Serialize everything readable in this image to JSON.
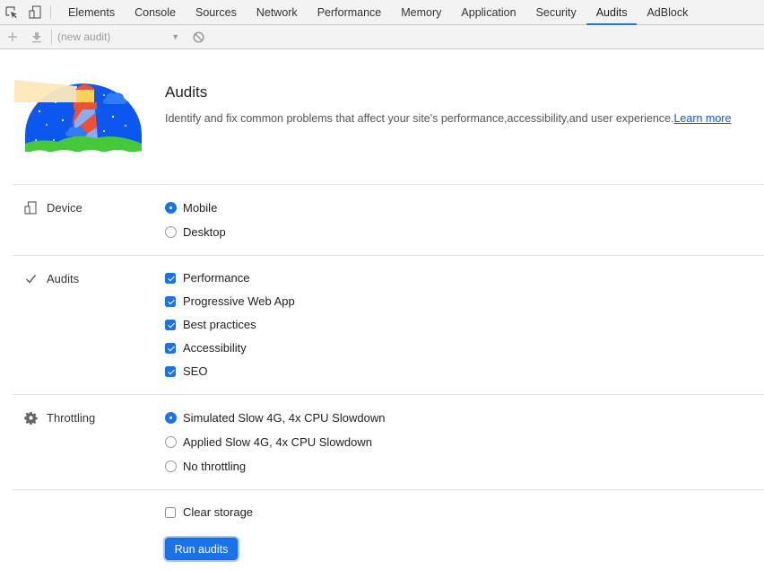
{
  "tabbar": {
    "tabs": [
      {
        "label": "Elements"
      },
      {
        "label": "Console"
      },
      {
        "label": "Sources"
      },
      {
        "label": "Network"
      },
      {
        "label": "Performance"
      },
      {
        "label": "Memory"
      },
      {
        "label": "Application"
      },
      {
        "label": "Security"
      },
      {
        "label": "Audits",
        "active": true
      },
      {
        "label": "AdBlock"
      }
    ],
    "icons": [
      "inspect-element-icon",
      "device-toolbar-icon"
    ]
  },
  "toolbar": {
    "audit_select_value": "(new audit)",
    "icons": [
      "add-icon",
      "download-icon",
      "clear-icon"
    ]
  },
  "header": {
    "title": "Audits",
    "description": "Identify and fix common problems that affect your site's performance,accessibility,and user experience.",
    "learn_more": "Learn more"
  },
  "sections": {
    "device": {
      "label": "Device",
      "icon": "device-icon",
      "options": [
        {
          "label": "Mobile",
          "selected": true
        },
        {
          "label": "Desktop",
          "selected": false
        }
      ]
    },
    "audits": {
      "label": "Audits",
      "icon": "checkmark-icon",
      "options": [
        {
          "label": "Performance",
          "checked": true
        },
        {
          "label": "Progressive Web App",
          "checked": true
        },
        {
          "label": "Best practices",
          "checked": true
        },
        {
          "label": "Accessibility",
          "checked": true
        },
        {
          "label": "SEO",
          "checked": true
        }
      ]
    },
    "throttling": {
      "label": "Throttling",
      "icon": "gear-icon",
      "options": [
        {
          "label": "Simulated Slow 4G, 4x CPU Slowdown",
          "selected": true
        },
        {
          "label": "Applied Slow 4G, 4x CPU Slowdown",
          "selected": false
        },
        {
          "label": "No throttling",
          "selected": false
        }
      ]
    }
  },
  "clear_storage": {
    "label": "Clear storage",
    "checked": false
  },
  "run_button": {
    "label": "Run audits"
  },
  "colors": {
    "accent": "#1a73e8",
    "link": "#1155cc"
  }
}
